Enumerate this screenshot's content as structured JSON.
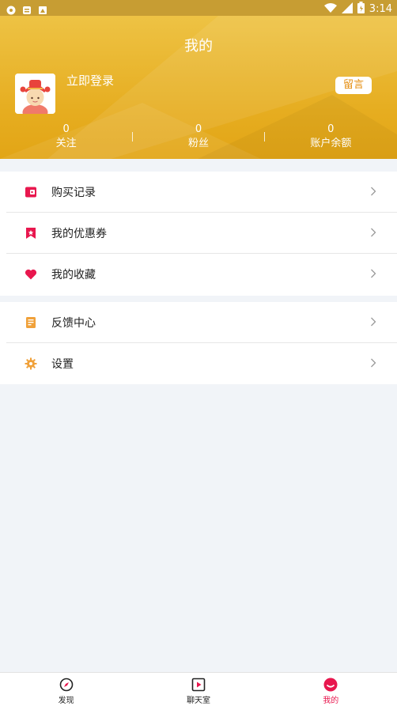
{
  "status_bar": {
    "time": "3:14"
  },
  "header": {
    "title": "我的",
    "login_text": "立即登录",
    "message_button": "留言",
    "stats": [
      {
        "value": "0",
        "label": "关注"
      },
      {
        "value": "0",
        "label": "粉丝"
      },
      {
        "value": "0",
        "label": "账户余额"
      }
    ]
  },
  "menu": {
    "group1": [
      {
        "label": "购买记录",
        "icon": "wallet-icon"
      },
      {
        "label": "我的优惠券",
        "icon": "coupon-bookmark-icon"
      },
      {
        "label": "我的收藏",
        "icon": "heart-icon"
      }
    ],
    "group2": [
      {
        "label": "反馈中心",
        "icon": "feedback-document-icon"
      },
      {
        "label": "设置",
        "icon": "gear-icon"
      }
    ]
  },
  "tabbar": {
    "tabs": [
      {
        "label": "发现",
        "icon": "compass-icon",
        "active": false
      },
      {
        "label": "聊天室",
        "icon": "play-square-icon",
        "active": false
      },
      {
        "label": "我的",
        "icon": "profile-icon",
        "active": true
      }
    ]
  },
  "colors": {
    "header_top": "#efc64a",
    "header_bottom": "#e2a516",
    "accent_pink": "#e8174e",
    "icon_orange": "#f0a13a",
    "message_text": "#e58d0e"
  }
}
